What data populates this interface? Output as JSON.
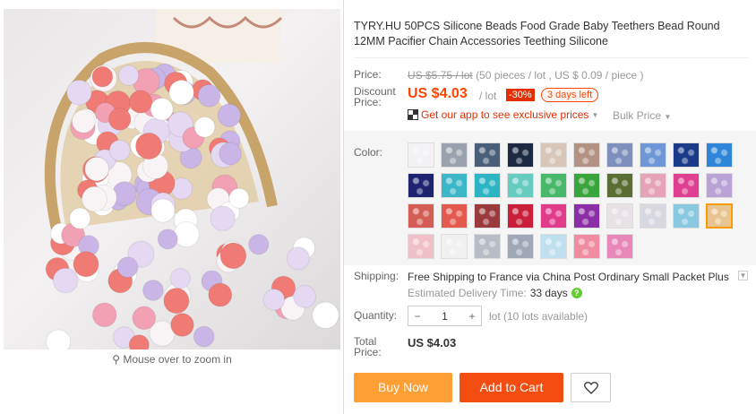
{
  "product": {
    "title": "TYRY.HU 50PCS Silicone Beads Food Grade Baby Teethers Bead Round 12MM Pacifier Chain Accessories Teething Silicone"
  },
  "zoom_hint": "Mouse over to zoom in",
  "price": {
    "label": "Price:",
    "original": "US $5.75 / lot",
    "original_note": "(50 pieces / lot , US $ 0.09 / piece )",
    "discount_label_1": "Discount",
    "discount_label_2": "Price:",
    "discount_value": "US $4.03",
    "per_lot": "/ lot",
    "discount_pct": "-30%",
    "days_left": "3 days left"
  },
  "promo": {
    "app_text": "Get our app to see exclusive prices",
    "bulk_text": "Bulk Price"
  },
  "color": {
    "label": "Color:",
    "swatches": [
      "#f2f2f4",
      "#9aa3ad",
      "#4a5f7a",
      "#1d2a44",
      "#d8c7b8",
      "#b49283",
      "#7d8fbd",
      "#6f96d6",
      "#1a3a8a",
      "#2f86d8",
      "#1e2470",
      "#3bb7c8",
      "#2eb5c4",
      "#66ccc0",
      "#48b86a",
      "#3aa53c",
      "#5a6e34",
      "#e6a3b8",
      "#de3f90",
      "#b9a3d6",
      "#d45e55",
      "#e4594d",
      "#9b3a3d",
      "#c91f3a",
      "#e03c8a",
      "#8c2ea6",
      "#e8e2e6",
      "#d8d8e0",
      "#88c8e0",
      "#e8c490",
      "#f0c0c8",
      "#f0f0f0",
      "#b8bcc4",
      "#a0a8b8",
      "#c0e0f0",
      "#f08ca0",
      "#e888b8"
    ],
    "selected_index": 29
  },
  "shipping": {
    "label": "Shipping:",
    "text": "Free Shipping to France via China Post Ordinary Small Packet Plus",
    "est_label": "Estimated Delivery Time:",
    "est_value": "33 days"
  },
  "quantity": {
    "label": "Quantity:",
    "minus": "−",
    "value": "1",
    "plus": "+",
    "available": "lot (10 lots available)"
  },
  "total": {
    "label_1": "Total",
    "label_2": "Price:",
    "value": "US $4.03"
  },
  "buttons": {
    "buy_now": "Buy Now",
    "add_to_cart": "Add to Cart"
  },
  "colors": {
    "accent": "#ff4400",
    "buy_now_bg": "#fe9f36",
    "add_to_cart_bg": "#f44d12"
  }
}
